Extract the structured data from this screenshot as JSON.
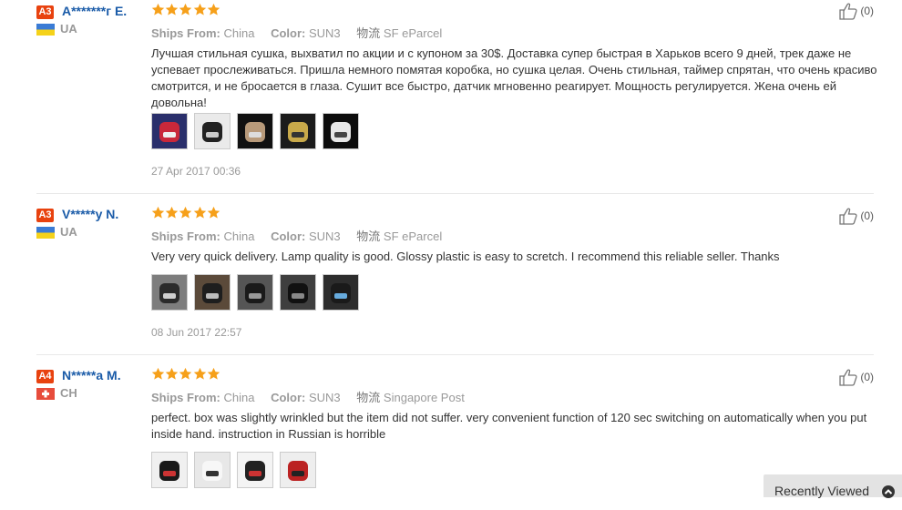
{
  "labels": {
    "ships_from": "Ships From:",
    "color": "Color:",
    "shipping_icon_glyph": "物流"
  },
  "reviews": [
    {
      "badge": "A3",
      "badge_color": "#e8420f",
      "name": "A*******г E.",
      "country": "UA",
      "flag": "ua",
      "stars": 5,
      "ships_from": "China",
      "color": "SUN3",
      "shipping": "SF eParcel",
      "text": "Лучшая стильная сушка, выхватил по акции и с купоном за 30$. Доставка супер быстрая в Харьков всего 9 дней, трек даже не успевает прослеживаться. Пришла немного помятая коробка, но сушка целая. Очень стильная, таймер спрятан, что очень красиво смотрится, и не бросается в глаза. Сушит все быстро, датчик мгновенно реагирует. Мощность регулируется. Жена очень ей довольна!",
      "date": "27 Apr 2017 00:36",
      "helpful": "(0)",
      "thumbs": [
        "box-red",
        "lamp-desk",
        "hand-light",
        "lamp-glow",
        "lamp-white"
      ]
    },
    {
      "badge": "A3",
      "badge_color": "#e8420f",
      "name": "V*****y N.",
      "country": "UA",
      "flag": "ua",
      "stars": 5,
      "ships_from": "China",
      "color": "SUN3",
      "shipping": "SF eParcel",
      "text": "Very very quick delivery. Lamp quality is good. Glossy plastic is easy to scretch. I recommend this reliable seller. Thanks",
      "date": "08 Jun 2017 22:57",
      "helpful": "(0)",
      "thumbs": [
        "lamp-gray-a",
        "lamp-gray-b",
        "lamp-gray-c",
        "lamp-gray-d",
        "lamp-gray-e"
      ]
    },
    {
      "badge": "A4",
      "badge_color": "#e8420f",
      "name": "N*****a M.",
      "country": "CH",
      "flag": "ch",
      "stars": 5,
      "ships_from": "China",
      "color": "SUN3",
      "shipping": "Singapore Post",
      "text": "perfect. box was slightly wrinkled but the item did not suffer. very convenient function of 120 sec switching on automatically when you put inside hand. instruction in Russian is horrible",
      "date": "",
      "helpful": "(0)",
      "thumbs": [
        "lamp-black",
        "lamp-white-b",
        "lamp-box",
        "lamp-red-box"
      ]
    }
  ],
  "recently_viewed": "Recently Viewed"
}
